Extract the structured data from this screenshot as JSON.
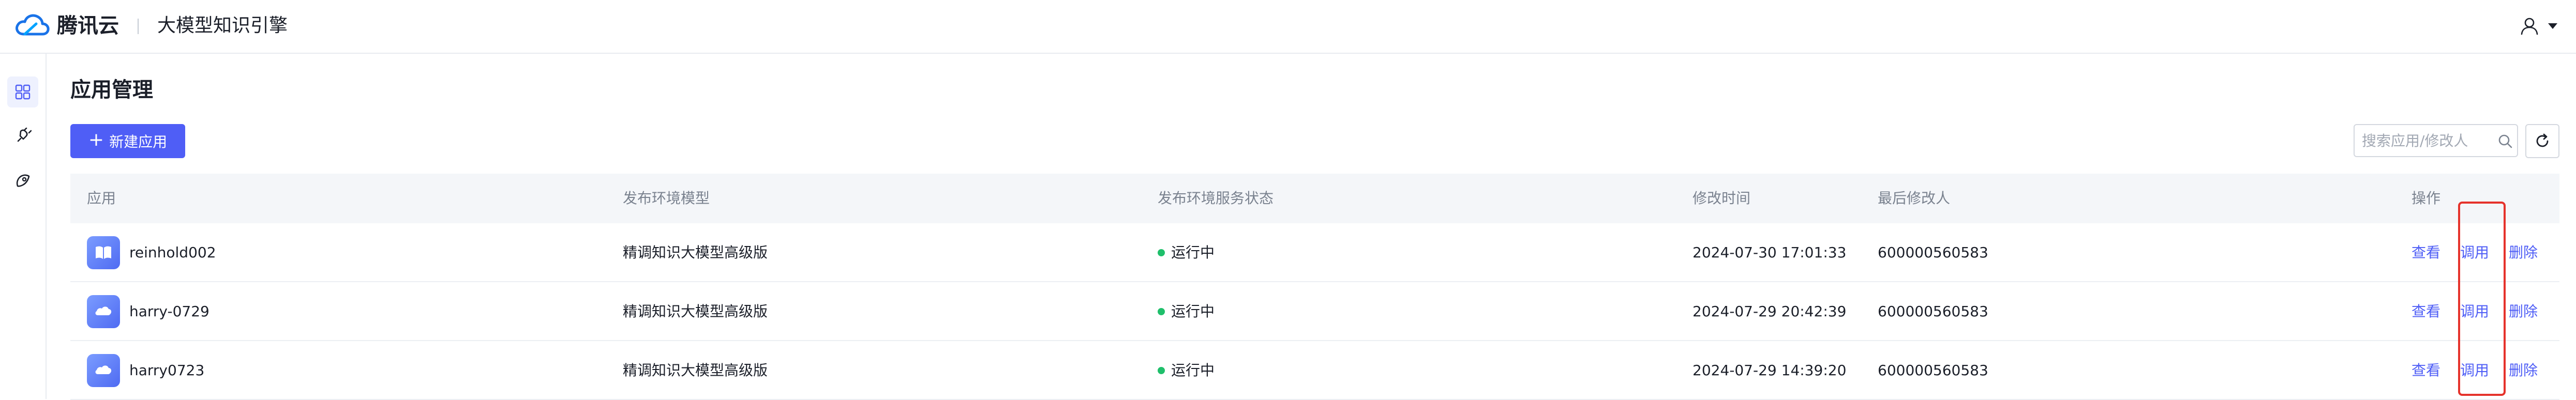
{
  "header": {
    "brand": "腾讯云",
    "product": "大模型知识引擎"
  },
  "sidebar": {
    "items": [
      {
        "icon": "app-grid-icon",
        "active": true
      },
      {
        "icon": "plug-icon",
        "active": false
      },
      {
        "icon": "rocket-icon",
        "active": false
      }
    ]
  },
  "main": {
    "title": "应用管理",
    "new_app_label": "新建应用",
    "search_placeholder": "搜索应用/修改人"
  },
  "table": {
    "columns": [
      "应用",
      "发布环境模型",
      "发布环境服务状态",
      "修改时间",
      "最后修改人",
      "操作"
    ],
    "rows": [
      {
        "name": "reinhold002",
        "model": "精调知识大模型高级版",
        "status": "运行中",
        "modified": "2024-07-30 17:01:33",
        "modifier": "600000560583",
        "avatar": "book-icon"
      },
      {
        "name": "harry-0729",
        "model": "精调知识大模型高级版",
        "status": "运行中",
        "modified": "2024-07-29 20:42:39",
        "modifier": "600000560583",
        "avatar": "cloud-icon"
      },
      {
        "name": "harry0723",
        "model": "精调知识大模型高级版",
        "status": "运行中",
        "modified": "2024-07-29 14:39:20",
        "modifier": "600000560583",
        "avatar": "cloud-icon"
      }
    ],
    "actions": {
      "view": "查看",
      "call": "调用",
      "delete": "删除"
    }
  },
  "colors": {
    "primary": "#4f5ef6",
    "status_running": "#1fbf6b",
    "highlight": "#e5322b"
  }
}
